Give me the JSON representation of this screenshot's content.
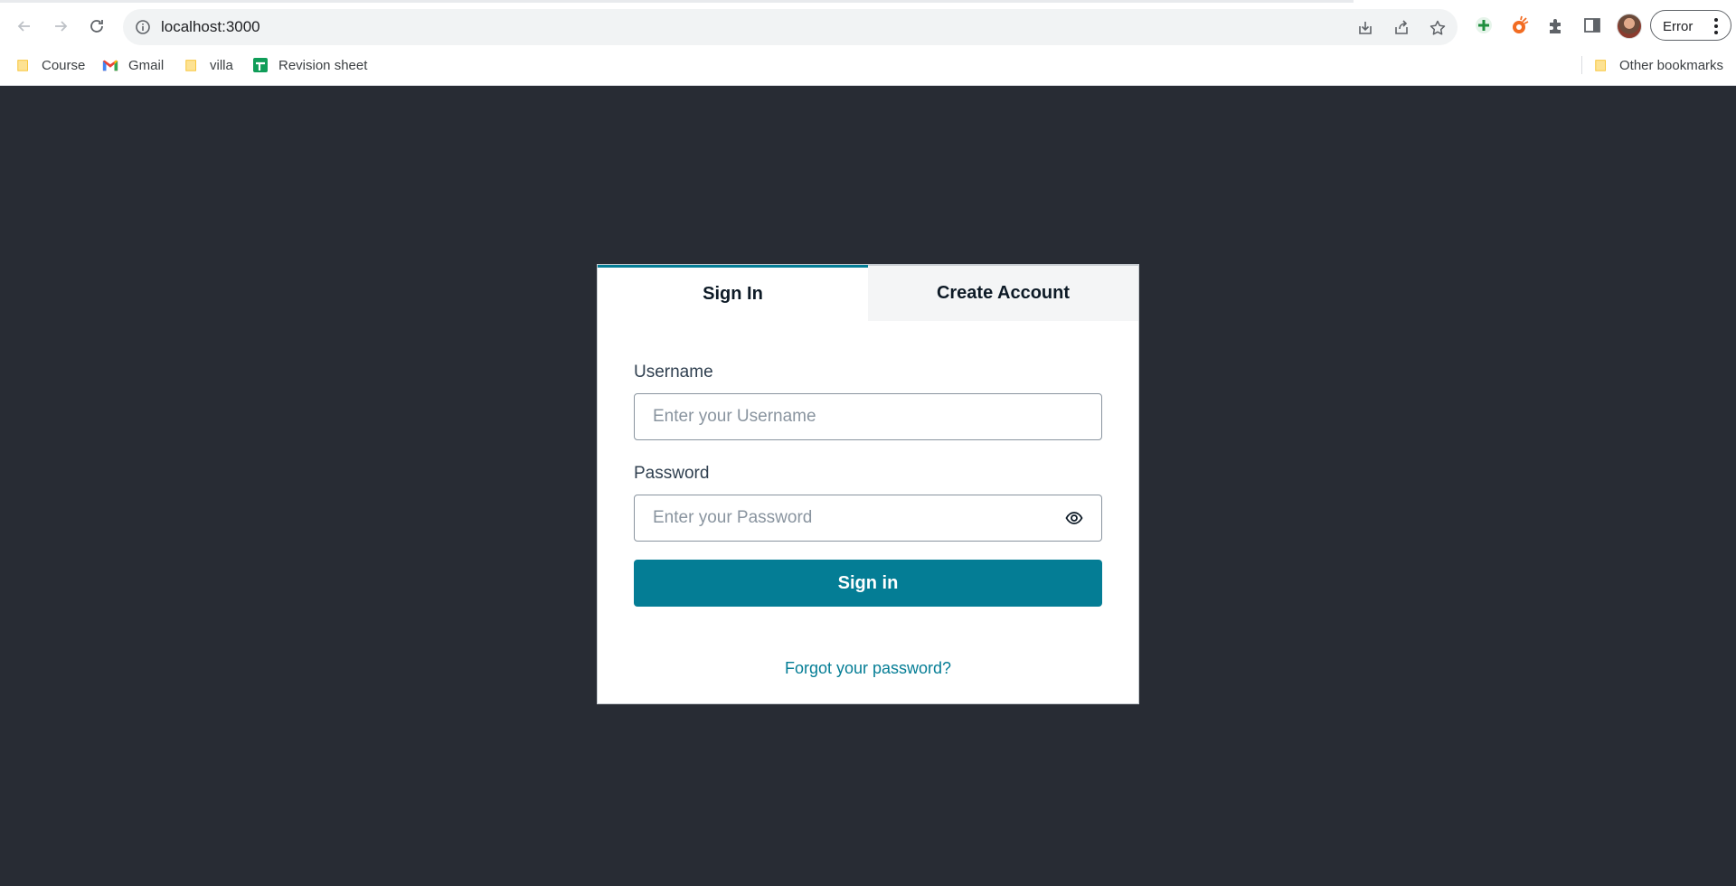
{
  "browser": {
    "url": "localhost:3000",
    "profile_button_label": "Error",
    "bookmarks": [
      {
        "label": "Course",
        "icon": "folder-icon"
      },
      {
        "label": "Gmail",
        "icon": "gmail-icon"
      },
      {
        "label": "villa",
        "icon": "folder-icon"
      },
      {
        "label": "Revision sheet",
        "icon": "google-sheets-icon"
      }
    ],
    "other_bookmarks_label": "Other bookmarks"
  },
  "auth": {
    "tabs": [
      {
        "label": "Sign In",
        "selected": true
      },
      {
        "label": "Create Account",
        "selected": false
      }
    ],
    "username": {
      "label": "Username",
      "placeholder": "Enter your Username",
      "value": ""
    },
    "password": {
      "label": "Password",
      "placeholder": "Enter your Password",
      "value": ""
    },
    "submit_label": "Sign in",
    "forgot_label": "Forgot your password?"
  },
  "colors": {
    "page_background": "#282c34",
    "accent": "#047d95",
    "card_background": "#ffffff"
  }
}
